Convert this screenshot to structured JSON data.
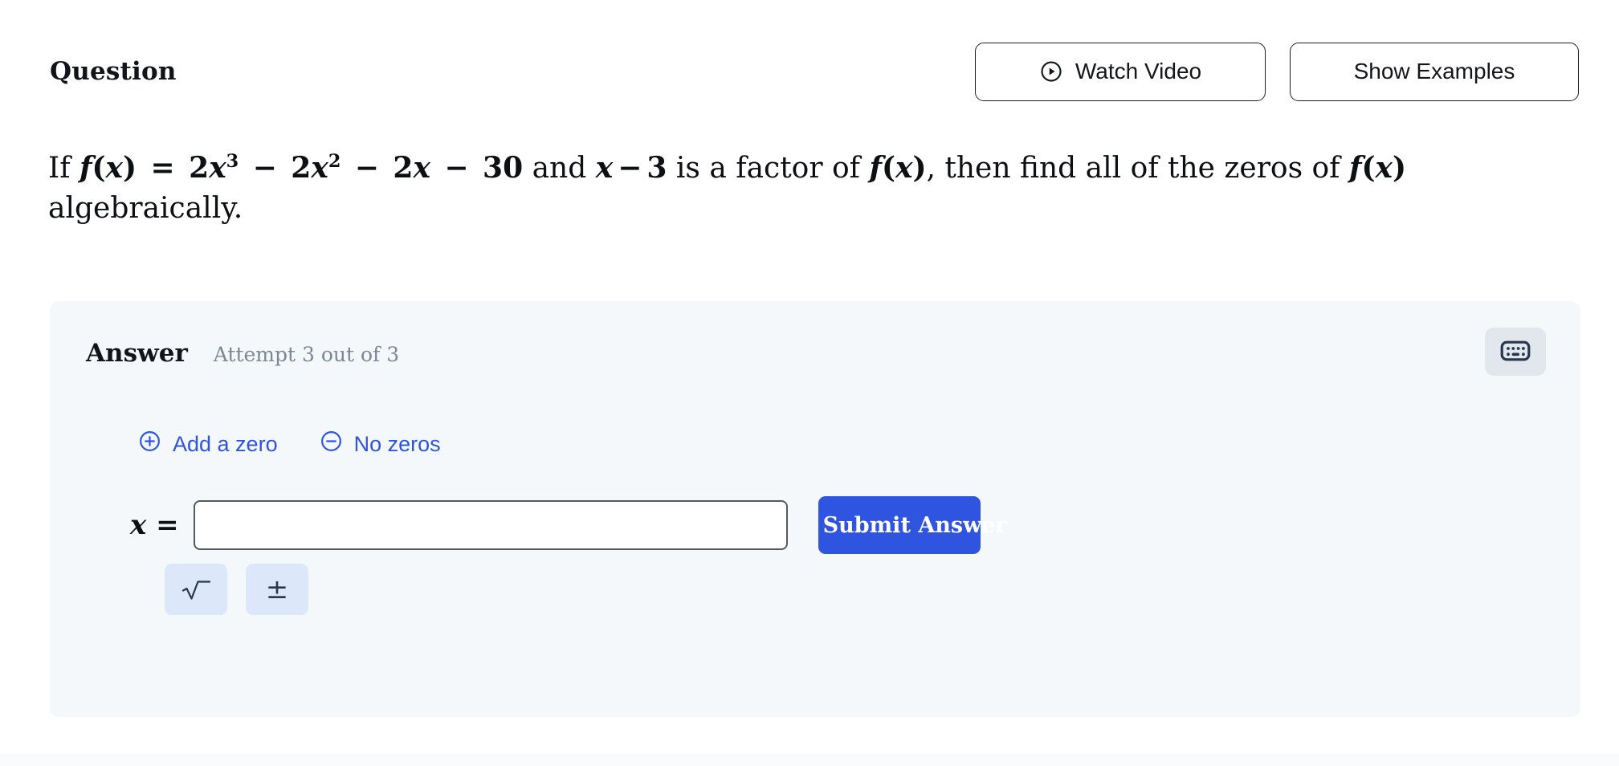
{
  "header": {
    "title": "Question",
    "watch_video_label": "Watch Video",
    "show_examples_label": "Show Examples",
    "play_icon": "play-circle-icon"
  },
  "question": {
    "prefix": "If",
    "function_name": "f",
    "equals": "=",
    "term1_coef": "2",
    "term1_var": "x",
    "term1_exp": "3",
    "minus1": "−",
    "term2_coef": "2",
    "term2_var": "x",
    "term2_exp": "2",
    "minus2": "−",
    "term3_coef": "2",
    "term3_var": "x",
    "minus3": "−",
    "constant": "30",
    "and_word": "and",
    "factor_var": "x",
    "factor_minus": "−",
    "factor_const": "3",
    "middle_text": "is a factor of",
    "tail_text": ", then find all of the zeros of",
    "second_line": "algebraically.",
    "paren_open": "(",
    "paren_close": ")",
    "var": "x",
    "full_text": "If f(x) = 2x³ − 2x² − 2x − 30 and x − 3 is a factor of f(x), then find all of the zeros of f(x) algebraically."
  },
  "answer_panel": {
    "label": "Answer",
    "attempt_text": "Attempt 3 out of 3",
    "keyboard_icon": "keyboard-icon",
    "add_zero_label": "Add a zero",
    "add_zero_icon": "plus-circle-icon",
    "no_zeros_label": "No zeros",
    "no_zeros_icon": "minus-circle-icon",
    "x_equals": "x =",
    "input_value": "",
    "input_placeholder": "",
    "submit_label": "Submit Answer",
    "symbol_keys": [
      {
        "name": "sqrt-key",
        "glyph": "√"
      },
      {
        "name": "plus-minus-key",
        "glyph": "±"
      }
    ]
  },
  "colors": {
    "accent_blue": "#2f54e0",
    "panel_bg": "#f4f8fb",
    "key_bg": "#dce8fa",
    "muted_text": "#7b8794",
    "kbd_btn_bg": "#e2e7ed",
    "icon_dark": "#27374d"
  }
}
